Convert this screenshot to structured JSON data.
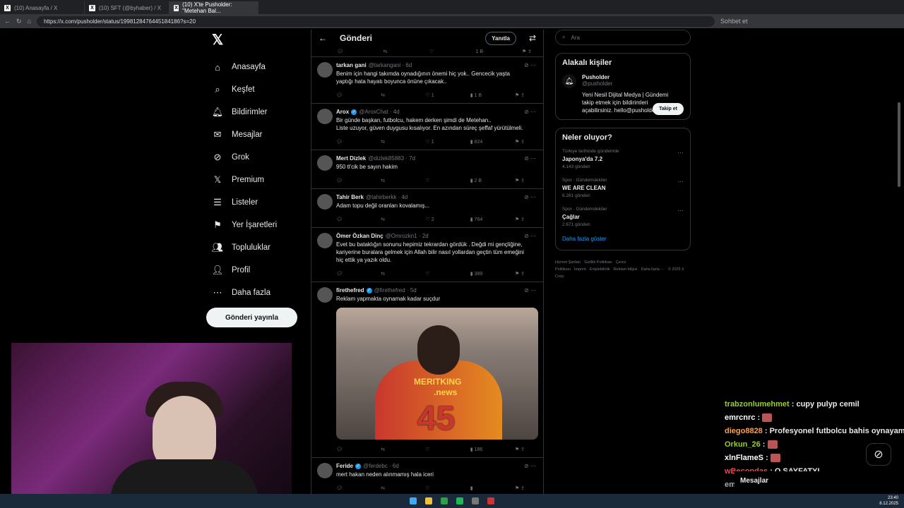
{
  "browser": {
    "tabs": [
      {
        "label": "(10) Anasayfa / X"
      },
      {
        "label": "(10) SFT (@byhaber) / X"
      },
      {
        "label": "(10) X'te Pusholder: \"Metehan Bal..."
      }
    ],
    "url": "https://x.com/pusholder/status/1998128476445184186?s=20",
    "profile_label": "Sohbet et"
  },
  "nav": {
    "items": [
      {
        "label": "Anasayfa",
        "icon": "home-icon"
      },
      {
        "label": "Keşfet",
        "icon": "search-icon"
      },
      {
        "label": "Bildirimler",
        "icon": "bell-icon"
      },
      {
        "label": "Mesajlar",
        "icon": "mail-icon"
      },
      {
        "label": "Grok",
        "icon": "grok-icon"
      },
      {
        "label": "Premium",
        "icon": "x-icon"
      },
      {
        "label": "Listeler",
        "icon": "list-icon"
      },
      {
        "label": "Yer İşaretleri",
        "icon": "bookmark-icon"
      },
      {
        "label": "Topluluklar",
        "icon": "people-icon"
      },
      {
        "label": "Profil",
        "icon": "user-icon"
      },
      {
        "label": "Daha fazla",
        "icon": "more-icon"
      }
    ],
    "post_label": "Gönderi yayınla"
  },
  "timeline": {
    "title": "Gönderi",
    "reply_label": "Yanıtla",
    "top_views": "1 B",
    "tweets": [
      {
        "name": "tarkan gani",
        "handle": "@tarkangani · 6d",
        "text": "Benim için hangi takımda oynadığının önemi hiç yok.. Gencecik yaşta\nyaptığı hata hayatı boyunca önüne çıkacak..",
        "likes": "1",
        "views": "1 B",
        "verified": false
      },
      {
        "name": "Arox",
        "handle": "@AroxChat · 4d",
        "text": "Bir günde başkan, futbolcu, hakem derken şimdi de Metehan..\nListe uzuyor, güven duygusu kısalıyor. En azından süreç şeffaf yürütülmeli.",
        "likes": "1",
        "views": "824",
        "verified": true
      },
      {
        "name": "Mert Dizlek",
        "handle": "@dizlek85883 · 7d",
        "text": "950 tl'cik be sayın hakim",
        "likes": "",
        "views": "2 B",
        "verified": false
      },
      {
        "name": "Tahir Berk",
        "handle": "@tahirberkk · 4d",
        "text": "Adam topu değil oranları kovalamış...",
        "likes": "2",
        "views": "764",
        "verified": false
      },
      {
        "name": "Ömer Özkan Dinç",
        "handle": "@Omrozkn1 · 2d",
        "text": "Evet bu bataklığın sonunu hepimiz tekrardan gördük . Değdi mi gençliğine,\nkariyerine buralara gelmek için Allah bilir nasıl yollardan geçtin tüm emeğini\nhiç ettik ya yazık oldu.",
        "likes": "",
        "views": "389",
        "verified": false
      },
      {
        "name": "firethefred",
        "handle": "@firethefred · 5d",
        "text": "Reklam yapmakta oynamak kadar suçdur",
        "likes": "",
        "views": "186",
        "verified": true
      },
      {
        "name": "Feride",
        "handle": "@ferdebc · 6d",
        "text": "mert hakan neden alınmamış hala iceri",
        "likes": "",
        "views": "",
        "verified": true
      }
    ],
    "media": {
      "sponsor_top": "MERITKING",
      "sponsor_bottom": ".news",
      "number": "45"
    }
  },
  "right": {
    "search_placeholder": "Ara",
    "people_title": "Alakalı kişiler",
    "person": {
      "name": "Pusholder",
      "handle": "@pusholder",
      "bio": "Yeni Nesil Dijital Medya | Gündemi\ntakip etmek için bildirimleri\naçabilirsiniz. hello@pusholder.com",
      "follow_label": "Takip et"
    },
    "trends_title": "Neler oluyor?",
    "trends": [
      {
        "context": "Türkiye tarihinde gündemde",
        "title": "Japonya'da 7.2",
        "count": "4.143 gönderi"
      },
      {
        "context": "Spor · Gündemdekiler",
        "title": "WE ARE CLEAN",
        "count": "6.281 gönderi"
      },
      {
        "context": "Spor · Gündemdekiler",
        "title": "Çağlar",
        "count": "2.671 gönderi"
      }
    ],
    "show_more": "Daha fazla göster",
    "footer": [
      "Hizmet Şartları",
      "Gizlilik Politikası",
      "Çerez Politikası",
      "İmprint",
      "Erişilebilirlik",
      "Reklam bilgisi",
      "Daha fazla ···",
      "© 2025 X Corp."
    ]
  },
  "chat": {
    "lines": [
      {
        "user": "trabzonlumehmet",
        "color": "#9acd32",
        "msg": "cupy pulyp cemil",
        "emote": false
      },
      {
        "user": "emrcnrc",
        "color": "#ffffff",
        "msg": "",
        "emote": true
      },
      {
        "user": "diego8828",
        "color": "#ff9f4a",
        "msg": "Profesyonel futbolcu bahis oynayamaz.",
        "emote": false
      },
      {
        "user": "Orkun_26",
        "color": "#9acd32",
        "msg": "",
        "emote": true
      },
      {
        "user": "xlnFlameS",
        "color": "#ffffff",
        "msg": "",
        "emote": true
      },
      {
        "user": "wBecondas",
        "color": "#ff4040",
        "msg": "O SAYFATYI",
        "emote": false
      },
      {
        "user": "emilbaba",
        "color": "#aaaaaa",
        "msg": "kocası",
        "emote": false
      }
    ],
    "drawer_label": "Mesajlar"
  },
  "taskbar": {
    "time": "23:40",
    "date": "8.12.2025"
  }
}
